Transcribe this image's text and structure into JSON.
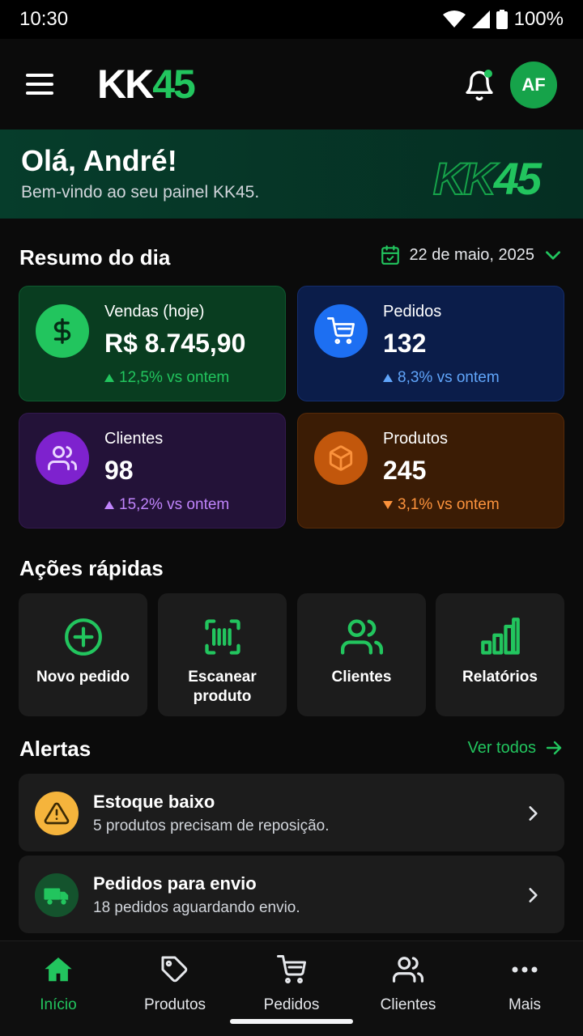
{
  "status_bar": {
    "time": "10:30",
    "battery": "100%"
  },
  "header": {
    "logo_white": "KK",
    "logo_green": "45",
    "avatar_initials": "AF"
  },
  "banner": {
    "title": "Olá, André!",
    "subtitle": "Bem-vindo ao seu painel KK45.",
    "logo_outline": "KK",
    "logo_green": "45"
  },
  "summary": {
    "title": "Resumo do dia",
    "date": "22 de maio, 2025",
    "cards": [
      {
        "label": "Vendas (hoje)",
        "value": "R$ 8.745,90",
        "change": "12,5% vs ontem",
        "trend": "up",
        "icon": "dollar-icon",
        "color": "#22c55e"
      },
      {
        "label": "Pedidos",
        "value": "132",
        "change": "8,3% vs ontem",
        "trend": "up",
        "icon": "cart-icon",
        "color": "#60a5fa"
      },
      {
        "label": "Clientes",
        "value": "98",
        "change": "15,2% vs ontem",
        "trend": "up",
        "icon": "users-icon",
        "color": "#c084fc"
      },
      {
        "label": "Produtos",
        "value": "245",
        "change": "3,1% vs ontem",
        "trend": "down",
        "icon": "box-icon",
        "color": "#fb923c"
      }
    ]
  },
  "quick_actions": {
    "title": "Ações rápidas",
    "items": [
      {
        "label": "Novo pedido",
        "icon": "plus-circle-icon"
      },
      {
        "label": "Escanear produto",
        "icon": "barcode-scan-icon"
      },
      {
        "label": "Clientes",
        "icon": "users-icon"
      },
      {
        "label": "Relatórios",
        "icon": "bar-chart-icon"
      }
    ]
  },
  "alerts": {
    "title": "Alertas",
    "see_all": "Ver todos",
    "items": [
      {
        "title": "Estoque baixo",
        "subtitle": "5 produtos precisam de reposição.",
        "icon": "warning-icon",
        "color": "#f59e0b"
      },
      {
        "title": "Pedidos para envio",
        "subtitle": "18 pedidos aguardando envio.",
        "icon": "truck-icon",
        "color": "#16a34a"
      }
    ]
  },
  "bottom_nav": {
    "items": [
      {
        "label": "Início",
        "icon": "home-icon",
        "active": true
      },
      {
        "label": "Produtos",
        "icon": "tag-icon",
        "active": false
      },
      {
        "label": "Pedidos",
        "icon": "cart-icon",
        "active": false
      },
      {
        "label": "Clientes",
        "icon": "users-icon",
        "active": false
      },
      {
        "label": "Mais",
        "icon": "more-dots-icon",
        "active": false
      }
    ]
  },
  "colors": {
    "accent": "#22c55e",
    "background": "#0b0b0b",
    "card": "#1c1c1c"
  }
}
